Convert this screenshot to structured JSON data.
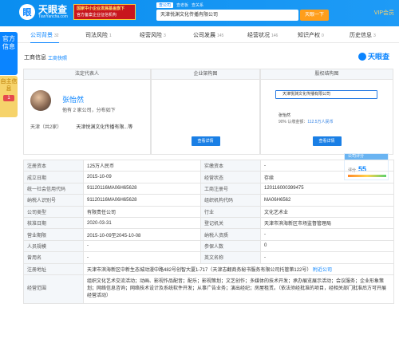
{
  "header": {
    "brand": "天眼查",
    "brand_url": "TianYancha.com",
    "promo_line1": "国家中小企业发展基金旗下",
    "promo_line2": "官方备案企业征信机构",
    "search_tabs": [
      "查公司",
      "查老板",
      "查关系"
    ],
    "search_value": "天津悦渊文化传播有限公司",
    "search_button": "天眼一下",
    "vip": "VIP会员"
  },
  "tabs": [
    {
      "label": "公司背景",
      "count": "32"
    },
    {
      "label": "司法风险",
      "count": "1"
    },
    {
      "label": "经营风险",
      "count": "3"
    },
    {
      "label": "公司发展",
      "count": "145"
    },
    {
      "label": "经营状况",
      "count": "146"
    },
    {
      "label": "知识产权",
      "count": "0"
    },
    {
      "label": "历史信息",
      "count": "3"
    }
  ],
  "side": {
    "official": "官方信息",
    "self": "自主信息",
    "self_count": "1"
  },
  "section": {
    "title": "工商信息",
    "sub": "工商快照",
    "brand": "天眼查"
  },
  "panels": {
    "legal_title": "法定代表人",
    "arch_title": "企业架构图",
    "equity_title": "股权结构图"
  },
  "person": {
    "name": "张怡然",
    "desc": "他有 2 家公司，分布如下",
    "region": "天津（共2家）",
    "company": "天津悦渊文化传播有限...等"
  },
  "equity": {
    "company": "天津悦渊文化传播有限公司",
    "holder": "张怡然",
    "holder_pct": "90%",
    "holder_capital": "认缴金额：",
    "holder_amount": "112.5万人民币"
  },
  "view_btn": "查看详情",
  "score": {
    "title": "公司评分",
    "label": "评分",
    "value": "55"
  },
  "table": [
    [
      "注册资本",
      "125万人民币",
      "实缴资本",
      "-"
    ],
    [
      "成立日期",
      "2015-10-09",
      "经营状态",
      "存续"
    ],
    [
      "统一社会信用代码",
      "91120116MA06H65628",
      "工商注册号",
      "120116000399475"
    ],
    [
      "纳税人识别号",
      "91120116MA06H65628",
      "组织机构代码",
      "MA06H6562"
    ],
    [
      "公司类型",
      "有限责任公司",
      "行业",
      "文化艺术业"
    ],
    [
      "核准日期",
      "2020-03-31",
      "登记机关",
      "天津市滨海新区市场监督管理局"
    ],
    [
      "营业期限",
      "2015-10-09至2045-10-08",
      "纳税人资质",
      "-"
    ],
    [
      "人员规模",
      "-",
      "参保人数",
      "0"
    ],
    [
      "曾用名",
      "-",
      "英文名称",
      "-"
    ]
  ],
  "address": {
    "label": "注册地址",
    "value": "天津市滨海新区中新生态城动漫中路482号创智大厦1-717（天津志翻商务秘书服务有限公司托管第122号）",
    "link": "附近公司"
  },
  "scope": {
    "label": "经营范围",
    "value": "组织文化艺术交流活动；动画、影视作品配音；配乐；影视策划；文艺创作；多媒体的技术开发；承办展览展示活动；会议服务；企业形象策划；网络信息咨询；网络技术设计及系统软件开发；从事广告业务；演出经纪；房屋租赁。（依法须经批准的项目，经相关部门批准后方可开展经营活动）"
  },
  "colors": {
    "brand": "#0a84ff",
    "accent": "#ff9e1b"
  }
}
